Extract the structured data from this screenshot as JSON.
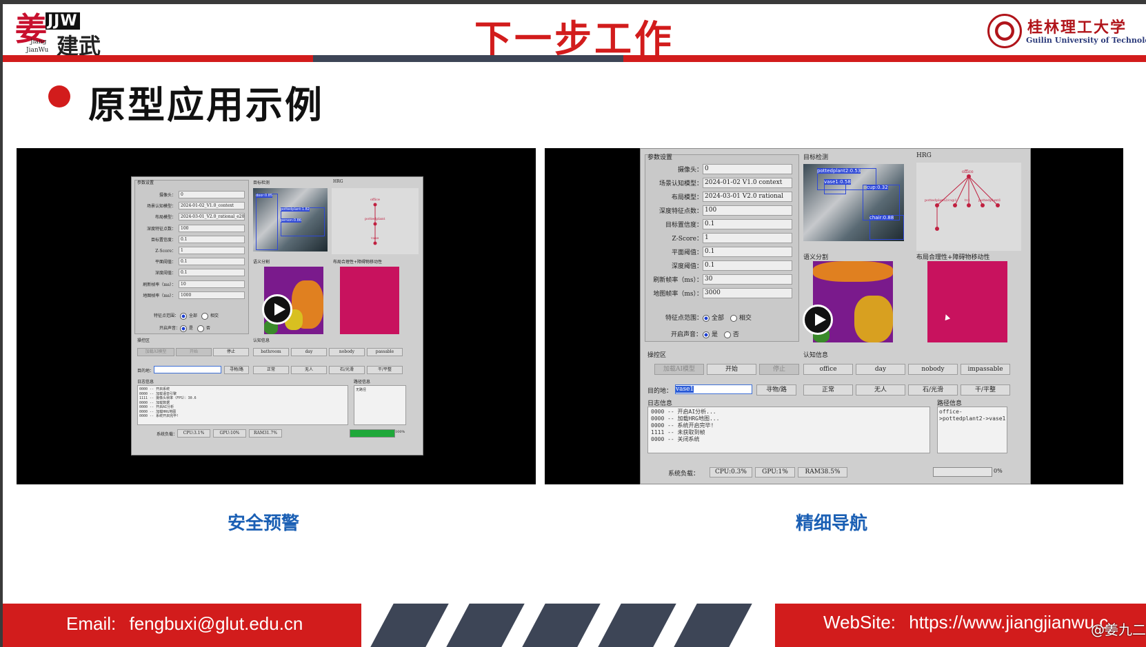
{
  "header": {
    "title": "下一步工作",
    "logo_left_char": "姜",
    "logo_left_mark": "JJW",
    "logo_left_en1": "Jiang",
    "logo_left_en2": "JianWu",
    "logo_left_cn": "建武",
    "logo_right_cn": "桂林理工大学",
    "logo_right_en": "Guilin University of Technology"
  },
  "section": {
    "title": "原型应用示例"
  },
  "colors": {
    "accent": "#d21c1c",
    "dark": "#3d4556",
    "caption": "#1a5fb4"
  },
  "video1": {
    "caption": "安全预警",
    "params_title": "参数设置",
    "params": [
      {
        "label": "摄像头：",
        "value": "0"
      },
      {
        "label": "场景认知模型：",
        "value": "2024-01-02_V1.0_context"
      },
      {
        "label": "布局模型：",
        "value": "2024-03-01_V2.0_rational_e2000"
      },
      {
        "label": "深度特征点数：",
        "value": "100"
      },
      {
        "label": "目标置信度：",
        "value": "0.1"
      },
      {
        "label": "Z-Score：",
        "value": "1"
      },
      {
        "label": "平面阈值：",
        "value": "0.1"
      },
      {
        "label": "深度阈值：",
        "value": "0.1"
      },
      {
        "label": "刷新帧率（ms）：",
        "value": "10"
      },
      {
        "label": "地图帧率（ms）：",
        "value": "1000"
      }
    ],
    "feature_range_label": "特征点范围：",
    "feature_opt1": "全部",
    "feature_opt2": "相交",
    "sound_label": "开启声音：",
    "sound_opt1": "是",
    "sound_opt2": "否",
    "detect_title": "目标检测",
    "detect_tag1": "door:0.85",
    "detect_tag2": "pottedplant:1.82",
    "detect_tag3": "person:0.86",
    "hrg_title": "HRG",
    "hrg_nodes": [
      "office",
      "pottedplant",
      "vase"
    ],
    "seg_title": "语义分割",
    "layout_title": "布局合理性+障碍物移动性",
    "ops_title": "操控区",
    "btn_load": "加载AI模型",
    "btn_start": "开始",
    "btn_stop": "停止",
    "cog_title": "认知信息",
    "cog": [
      "bathroom",
      "day",
      "nobody",
      "passable"
    ],
    "dest_label": "目的地：",
    "btn_find": "寻物/路",
    "cog2": [
      "正常",
      "无人",
      "石/光滑",
      "干/平整"
    ],
    "log_title": "日志信息",
    "log": "0000 -- 开启系统\n0000 -- 加载语音引擎\n1111 -- 摄像头帧率（FPS）：30.6\n0000 -- 加载数据\n0000 -- 开启AI分析\n0000 -- 加载HRG地图\n0000 -- 系统开启完毕!",
    "path_title": "路径信息",
    "path": "无路径",
    "load_label": "系统负载：",
    "cpu": "CPU:3.1%",
    "gpu": "GPU:10%",
    "ram": "RAM31.7%",
    "gpu_pct": "100%"
  },
  "video2": {
    "caption": "精细导航",
    "params_title": "参数设置",
    "params": [
      {
        "label": "摄像头：",
        "value": "0"
      },
      {
        "label": "场景认知模型：",
        "value": "2024-01-02 V1.0 context"
      },
      {
        "label": "布局模型：",
        "value": "2024-03-01 V2.0 rational"
      },
      {
        "label": "深度特征点数：",
        "value": "100"
      },
      {
        "label": "目标置信度：",
        "value": "0.1"
      },
      {
        "label": "Z-Score：",
        "value": "1"
      },
      {
        "label": "平面阈值：",
        "value": "0.1"
      },
      {
        "label": "深度阈值：",
        "value": "0.1"
      },
      {
        "label": "刷新帧率（ms）：",
        "value": "30"
      },
      {
        "label": "地图帧率（ms）：",
        "value": "3000"
      }
    ],
    "feature_range_label": "特征点范围：",
    "feature_opt1": "全部",
    "feature_opt2": "相交",
    "sound_label": "开启声音：",
    "sound_opt1": "是",
    "sound_opt2": "否",
    "detect_title": "目标检测",
    "detect_tag1": "pottedplant2:0.53",
    "detect_tag2": "vase1:0.58",
    "detect_tag3": "cup:0.32",
    "detect_tag4": "chair:0.88",
    "hrg_title": "HRG",
    "hrg_nodes": [
      "office",
      "pottedplant2/cup1",
      "tv1",
      "pottedplant1"
    ],
    "seg_title": "语义分割",
    "layout_title": "布局合理性+障碍物移动性",
    "ops_title": "操控区",
    "btn_load": "加载AI模型",
    "btn_start": "开始",
    "btn_stop": "停止",
    "cog_title": "认知信息",
    "cog": [
      "office",
      "day",
      "nobody",
      "impassable"
    ],
    "dest_label": "目的地：",
    "dest_value": "vase1",
    "btn_find": "寻物/路",
    "cog2": [
      "正常",
      "无人",
      "石/光滑",
      "干/平整"
    ],
    "log_title": "日志信息",
    "log": "0000 -- 开启AI分析...\n0000 -- 加载HRG地图...\n0000 -- 系统开启完毕!\n1111 -- 未获取到帧\n0000 -- 关闭系统",
    "path_title": "路径信息",
    "path": "office-\n>pottedplant2->vase1",
    "load_label": "系统负载：",
    "cpu": "CPU:0.3%",
    "gpu": "GPU:1%",
    "ram": "RAM38.5%",
    "gpu_pct": "0%"
  },
  "footer": {
    "email_label": "Email:",
    "email": "fengbuxi@glut.edu.cn",
    "web_label": "WebSite:",
    "web": "https://www.jiangjianwu.c",
    "watermark": "@姜九二"
  }
}
